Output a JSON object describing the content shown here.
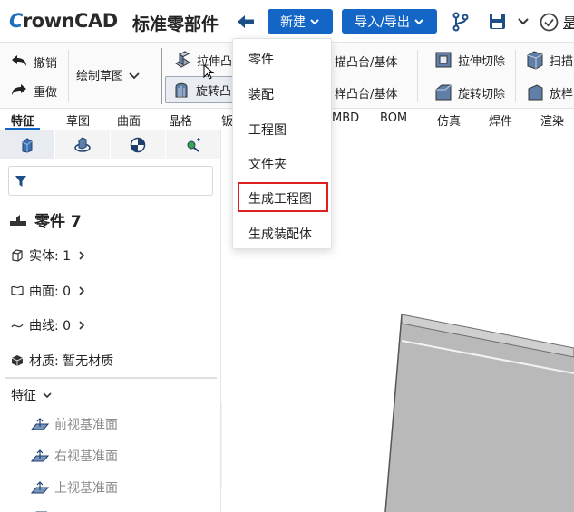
{
  "app": {
    "logo_c": "C",
    "logo_rest": "rownCAD",
    "doc_title": "标准零部件",
    "new_label": "新建",
    "io_label": "导入/导出",
    "cut_text": "是"
  },
  "ribbon": {
    "undo": "撤销",
    "redo": "重做",
    "sketch": "绘制草图",
    "extrude_boss": "拉伸凸",
    "revolve_boss": "旋转凸",
    "sweep_boss": "描凸台/基体",
    "loft_boss": "样凸台/基体",
    "extrude_cut": "拉伸切除",
    "revolve_cut": "旋转切除",
    "sweep": "扫描",
    "loft": "放样"
  },
  "tabs": [
    "特征",
    "草图",
    "曲面",
    "晶格",
    "钣",
    "MBD",
    "BOM",
    "仿真",
    "焊件",
    "渲染"
  ],
  "panel": {
    "part_name": "零件 7",
    "solid_label": "实体: 1",
    "surface_label": "曲面: 0",
    "curve_label": "曲线: 0",
    "material_label": "材质: 暂无材质",
    "feature_label": "特征",
    "planes": [
      "前视基准面",
      "右视基准面",
      "上视基准面"
    ]
  },
  "dropdown": {
    "items": [
      "零件",
      "装配",
      "工程图",
      "文件夹",
      "生成工程图",
      "生成装配体"
    ],
    "highlighted_index": 4
  },
  "colors": {
    "accent": "#1466c6",
    "highlight_border": "#e02020"
  }
}
